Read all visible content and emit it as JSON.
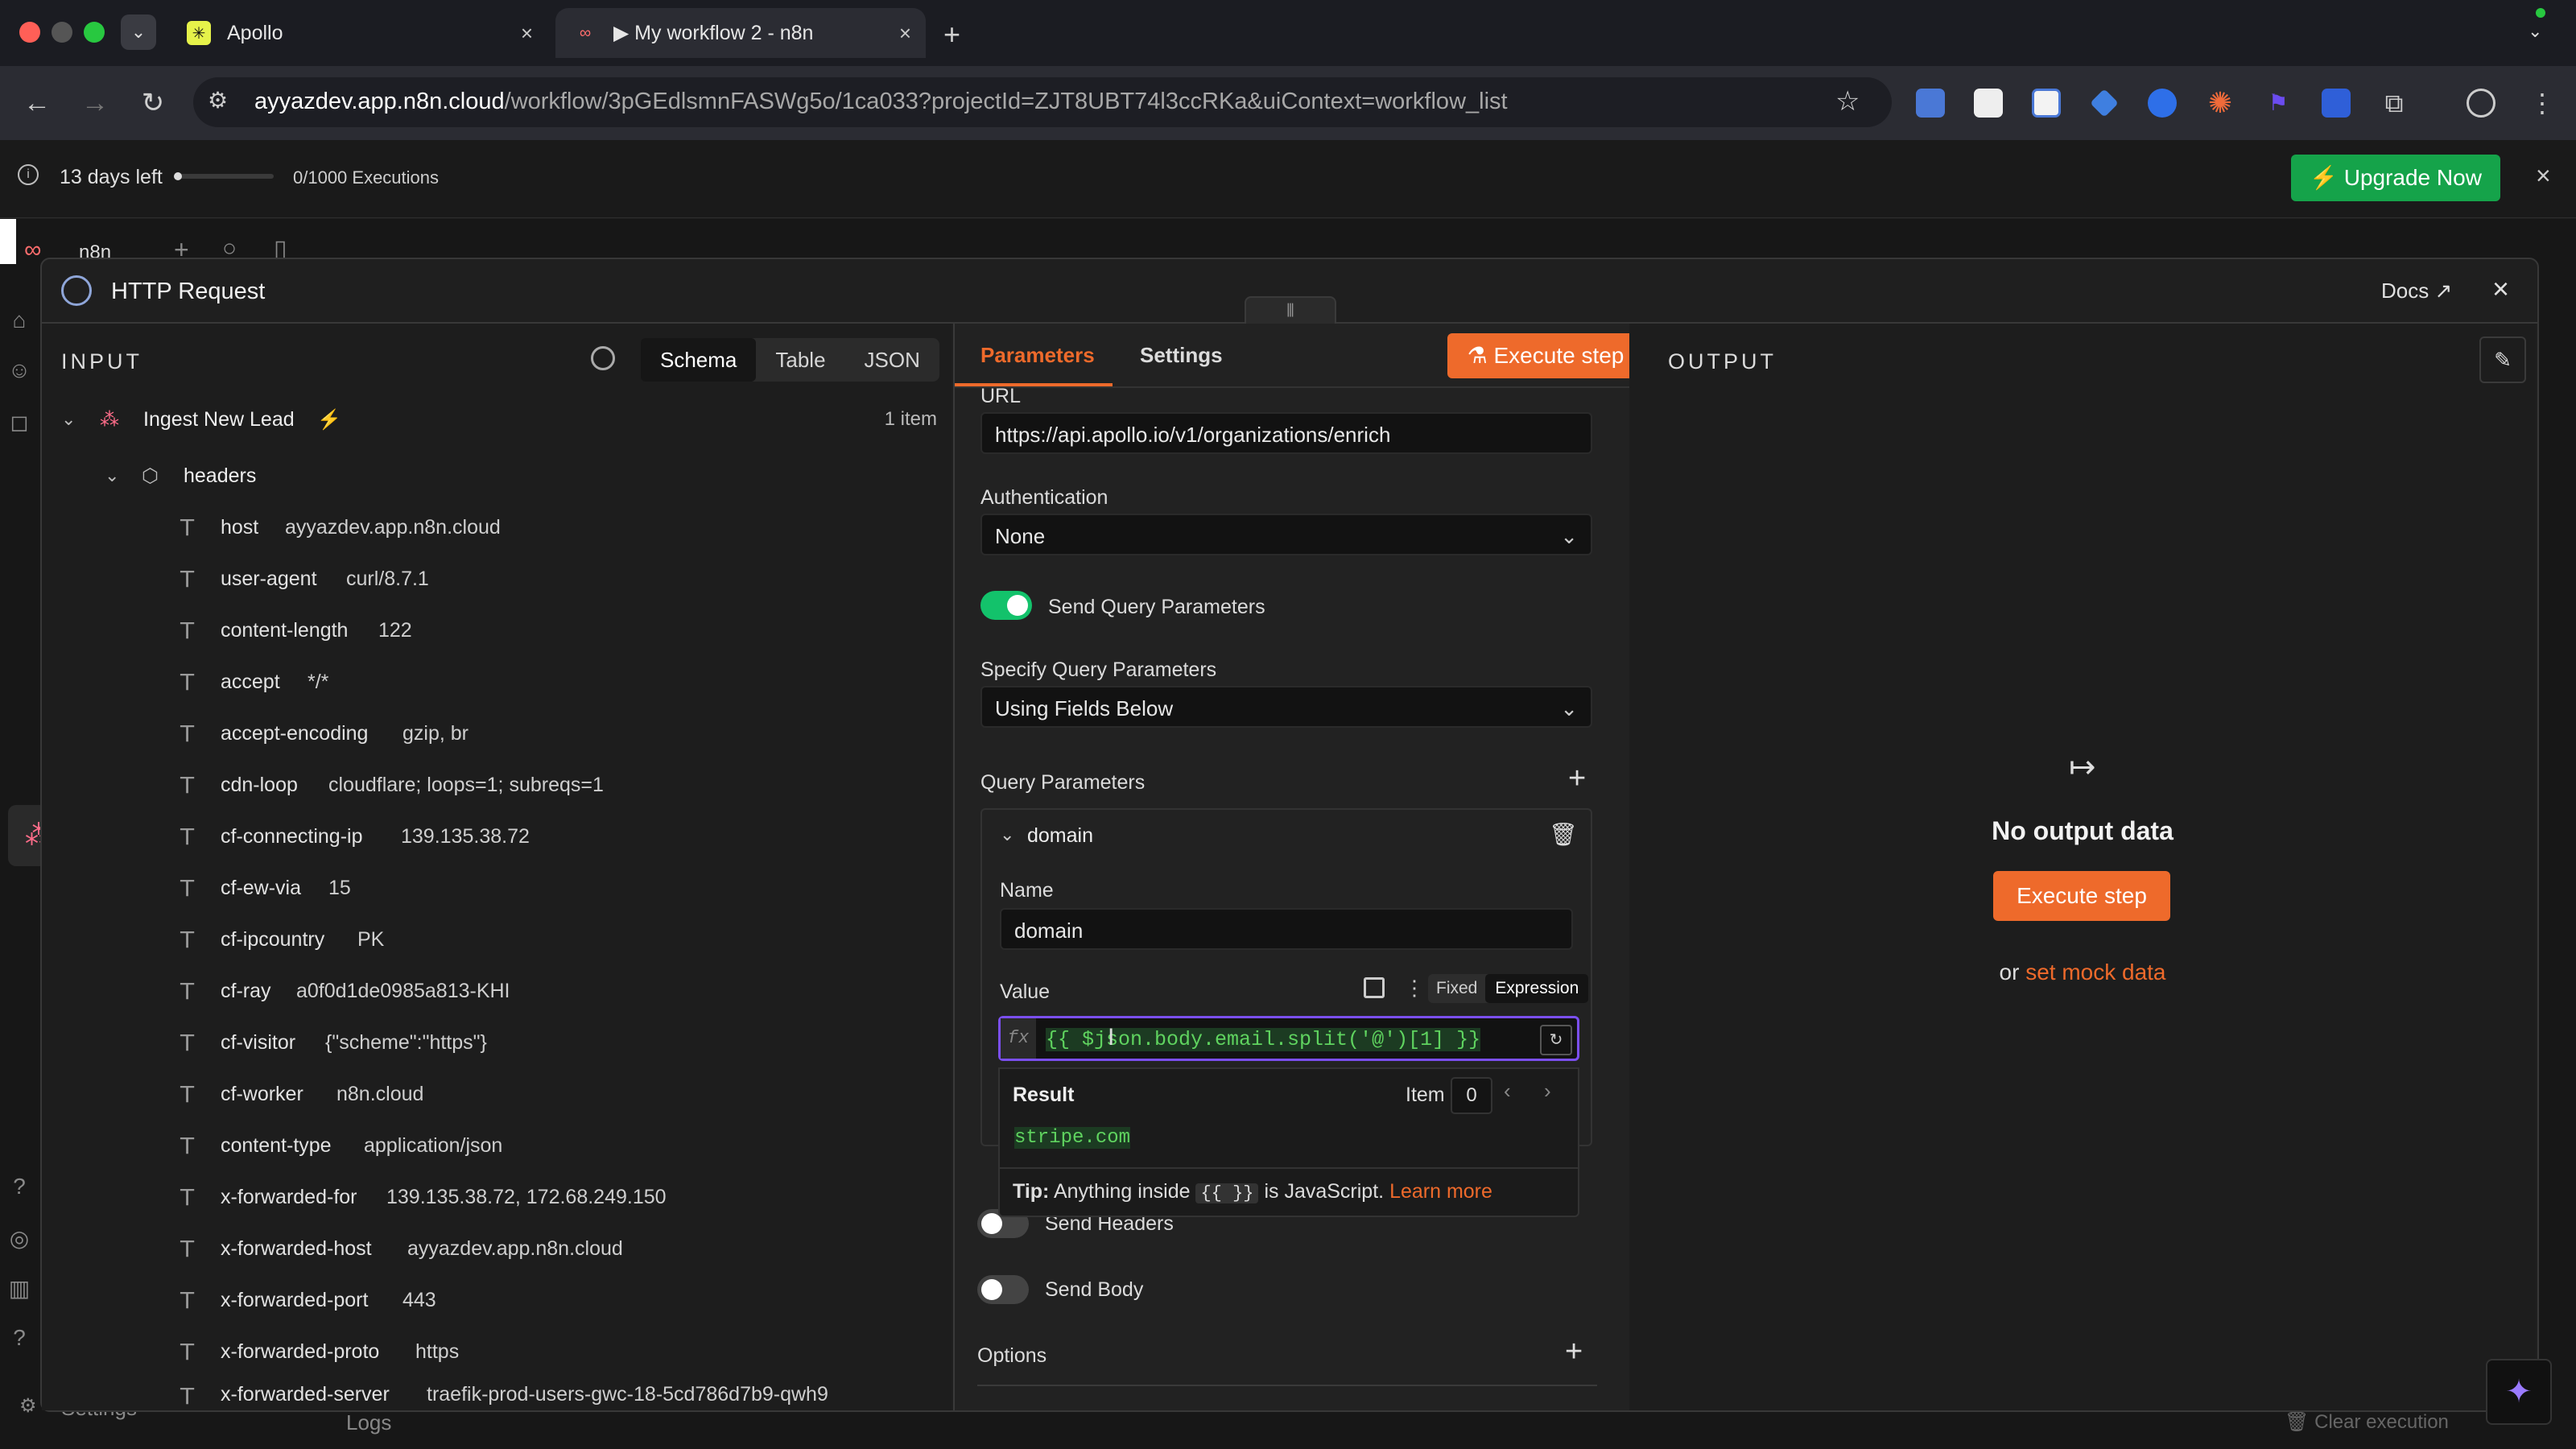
{
  "browser": {
    "tabs": [
      {
        "title": "Apollo",
        "active": false
      },
      {
        "title": "▶ My workflow 2 - n8n",
        "active": true
      }
    ],
    "url_host": "ayyazdev.app.n8n.cloud",
    "url_path": "/workflow/3pGEdlsmnFASWg5o/1ca033?projectId=ZJT8UBT74l3ccRKa&uiContext=workflow_list"
  },
  "trial": {
    "days_left": "13 days left",
    "executions": "0/1000 Executions",
    "upgrade_label": "Upgrade Now"
  },
  "background": {
    "logo_text": "n8n",
    "settings_label": "Settings",
    "logs_label": "Logs",
    "clear_execution": "Clear execution"
  },
  "modal": {
    "title": "HTTP Request",
    "docs_label": "Docs",
    "input": {
      "heading": "INPUT",
      "view_tabs": [
        "Schema",
        "Table",
        "JSON"
      ],
      "active_view": "Schema",
      "node_name": "Ingest New Lead",
      "item_count": "1 item",
      "group": "headers",
      "fields": [
        {
          "key": "host",
          "value": "ayyazdev.app.n8n.cloud"
        },
        {
          "key": "user-agent",
          "value": "curl/8.7.1"
        },
        {
          "key": "content-length",
          "value": "122"
        },
        {
          "key": "accept",
          "value": "*/*"
        },
        {
          "key": "accept-encoding",
          "value": "gzip, br"
        },
        {
          "key": "cdn-loop",
          "value": "cloudflare; loops=1; subreqs=1"
        },
        {
          "key": "cf-connecting-ip",
          "value": "139.135.38.72"
        },
        {
          "key": "cf-ew-via",
          "value": "15"
        },
        {
          "key": "cf-ipcountry",
          "value": "PK"
        },
        {
          "key": "cf-ray",
          "value": "a0f0d1de0985a813-KHI"
        },
        {
          "key": "cf-visitor",
          "value": "{\"scheme\":\"https\"}"
        },
        {
          "key": "cf-worker",
          "value": "n8n.cloud"
        },
        {
          "key": "content-type",
          "value": "application/json"
        },
        {
          "key": "x-forwarded-for",
          "value": "139.135.38.72, 172.68.249.150"
        },
        {
          "key": "x-forwarded-host",
          "value": "ayyazdev.app.n8n.cloud"
        },
        {
          "key": "x-forwarded-port",
          "value": "443"
        },
        {
          "key": "x-forwarded-proto",
          "value": "https"
        },
        {
          "key": "x-forwarded-server",
          "value": "traefik-prod-users-gwc-18-5cd786d7b9-qwh9"
        }
      ]
    },
    "params": {
      "tabs": [
        "Parameters",
        "Settings"
      ],
      "active_tab": "Parameters",
      "execute_label": "Execute step",
      "url_label": "URL",
      "url_value": "https://api.apollo.io/v1/organizations/enrich",
      "auth_label": "Authentication",
      "auth_value": "None",
      "send_query_label": "Send Query Parameters",
      "send_query_on": true,
      "specify_label": "Specify Query Parameters",
      "specify_value": "Using Fields Below",
      "query_params_label": "Query Parameters",
      "param_name_header": "domain",
      "name_label": "Name",
      "name_value": "domain",
      "value_label": "Value",
      "mode_fixed": "Fixed",
      "mode_expression": "Expression",
      "expression": "{{ $json.body.email.split('@')[1] }}",
      "fx": "fx",
      "result_label": "Result",
      "item_label": "Item",
      "item_index": "0",
      "result_value": "stripe.com",
      "tip_prefix": "Tip:",
      "tip_text": "Anything inside",
      "tip_code": "{{ }}",
      "tip_suffix": "is JavaScript.",
      "tip_link": "Learn more",
      "send_headers_label": "Send Headers",
      "send_body_label": "Send Body",
      "options_label": "Options"
    },
    "output": {
      "heading": "OUTPUT",
      "empty_title": "No output data",
      "execute_label": "Execute step",
      "or_text": "or",
      "mock_link": "set mock data"
    }
  },
  "colors": {
    "accent_orange": "#ee6a2b",
    "toggle_green": "#13c26b",
    "upgrade_green": "#15a34a",
    "expression_purple": "#7b4ff0",
    "result_green": "#5fd35f"
  }
}
